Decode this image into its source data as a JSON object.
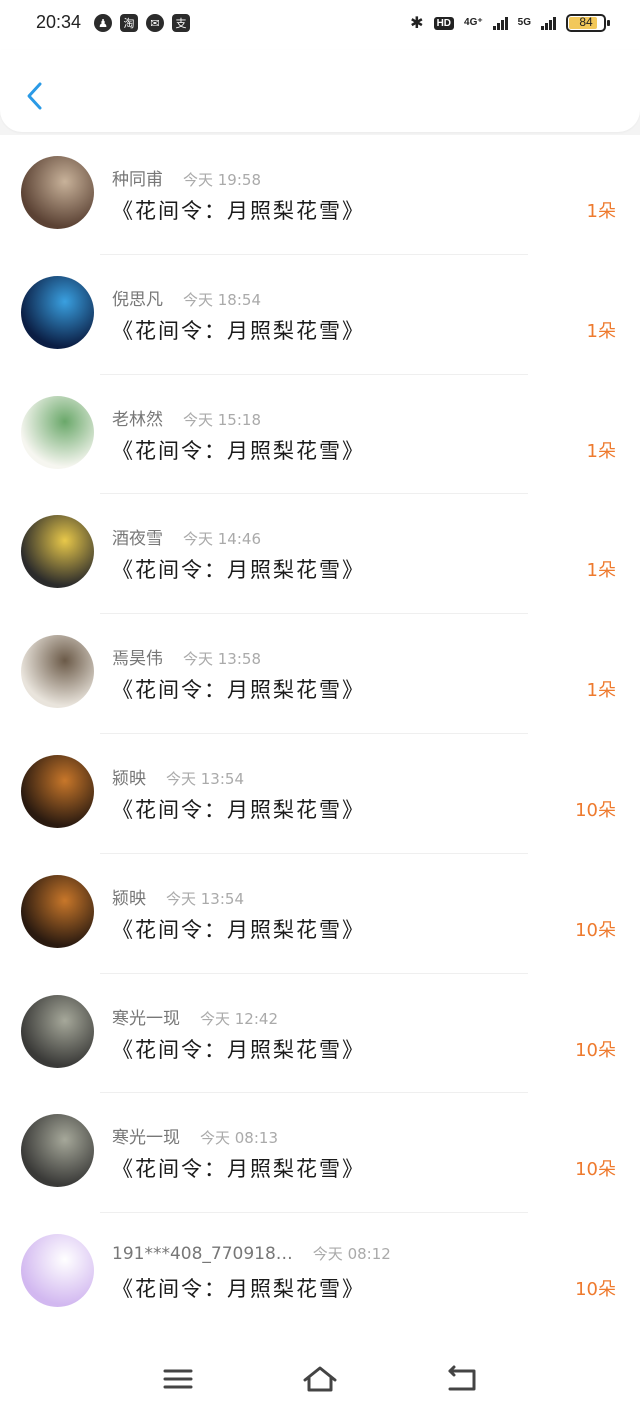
{
  "status_bar": {
    "time": "20:34",
    "left_icons": [
      "qq-icon",
      "taobao-icon",
      "wechat-icon",
      "alipay-icon"
    ],
    "left_glyphs": [
      "♟",
      "淘",
      "✉",
      "支"
    ],
    "bluetooth": "✱",
    "hd_badge": "HD",
    "network_4g": "4G⁺",
    "network_5g": "5G",
    "battery_level": 84,
    "battery_text": "84",
    "battery_color": "#f2c85a"
  },
  "header": {
    "back_label": "返回",
    "accent_color": "#2a9ae6"
  },
  "gifts": [
    {
      "name": "种同甫",
      "time": "今天 19:58",
      "title": "《花间令：月照梨花雪》",
      "amount": "1朵",
      "avatar_colors": [
        "#5b4234",
        "#c8b29a"
      ]
    },
    {
      "name": "倪思凡",
      "time": "今天 18:54",
      "title": "《花间令：月照梨花雪》",
      "amount": "1朵",
      "avatar_colors": [
        "#0b1e44",
        "#3aa0e0"
      ]
    },
    {
      "name": "老林然",
      "time": "今天 15:18",
      "title": "《花间令：月照梨花雪》",
      "amount": "1朵",
      "avatar_colors": [
        "#f6f6f0",
        "#6aa86a"
      ]
    },
    {
      "name": "酒夜雪",
      "time": "今天 14:46",
      "title": "《花间令：月照梨花雪》",
      "amount": "1朵",
      "avatar_colors": [
        "#2b2b2b",
        "#e8c84a"
      ]
    },
    {
      "name": "焉昊伟",
      "time": "今天 13:58",
      "title": "《花间令：月照梨花雪》",
      "amount": "1朵",
      "avatar_colors": [
        "#e9e4dc",
        "#6b5a48"
      ]
    },
    {
      "name": "颍映",
      "time": "今天 13:54",
      "title": "《花间令：月照梨花雪》",
      "amount": "10朵",
      "avatar_colors": [
        "#2a1a10",
        "#c8772a"
      ]
    },
    {
      "name": "颍映",
      "time": "今天 13:54",
      "title": "《花间令：月照梨花雪》",
      "amount": "10朵",
      "avatar_colors": [
        "#2a1a10",
        "#c8772a"
      ]
    },
    {
      "name": "寒光一现",
      "time": "今天 12:42",
      "title": "《花间令：月照梨花雪》",
      "amount": "10朵",
      "avatar_colors": [
        "#3a3a38",
        "#a6a89a"
      ]
    },
    {
      "name": "寒光一现",
      "time": "今天 08:13",
      "title": "《花间令：月照梨花雪》",
      "amount": "10朵",
      "avatar_colors": [
        "#3a3a38",
        "#a6a89a"
      ]
    },
    {
      "name": "191***408_770918…",
      "time": "今天 08:12",
      "title": "《花间令：月照梨花雪》",
      "amount": "10朵",
      "avatar_colors": [
        "#d2b8f0",
        "#ffffff"
      ]
    }
  ],
  "nav_bar": {
    "menu_label": "菜单",
    "home_label": "主页",
    "back_label": "返回"
  },
  "colors": {
    "amount": "#ee7a2e",
    "meta": "#888888",
    "title": "#1b1b1b"
  }
}
